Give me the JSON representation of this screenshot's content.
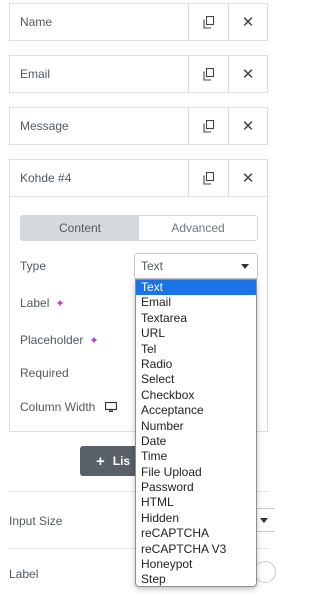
{
  "rows": [
    {
      "title": "Name"
    },
    {
      "title": "Email"
    },
    {
      "title": "Message"
    },
    {
      "title": "Kohde #4"
    }
  ],
  "tabs": {
    "content": "Content",
    "advanced": "Advanced"
  },
  "fields": {
    "type_label": "Type",
    "type_value": "Text",
    "label_label": "Label",
    "placeholder_label": "Placeholder",
    "required_label": "Required",
    "column_width_label": "Column Width"
  },
  "add_button": {
    "label": "Lis"
  },
  "panel": {
    "input_size_label": "Input Size",
    "label_label": "Label"
  },
  "dropdown_options": [
    "Text",
    "Email",
    "Textarea",
    "URL",
    "Tel",
    "Radio",
    "Select",
    "Checkbox",
    "Acceptance",
    "Number",
    "Date",
    "Time",
    "File Upload",
    "Password",
    "HTML",
    "Hidden",
    "reCAPTCHA",
    "reCAPTCHA V3",
    "Honeypot",
    "Step"
  ],
  "icons": {
    "duplicate": "duplicate-icon",
    "remove": "close-icon",
    "ai": "sparkle-icon",
    "responsive": "desktop-icon"
  },
  "colors": {
    "selected_option": "#1a73e8",
    "ai_accent": "#c036d6",
    "button_bg": "#5a6068"
  }
}
